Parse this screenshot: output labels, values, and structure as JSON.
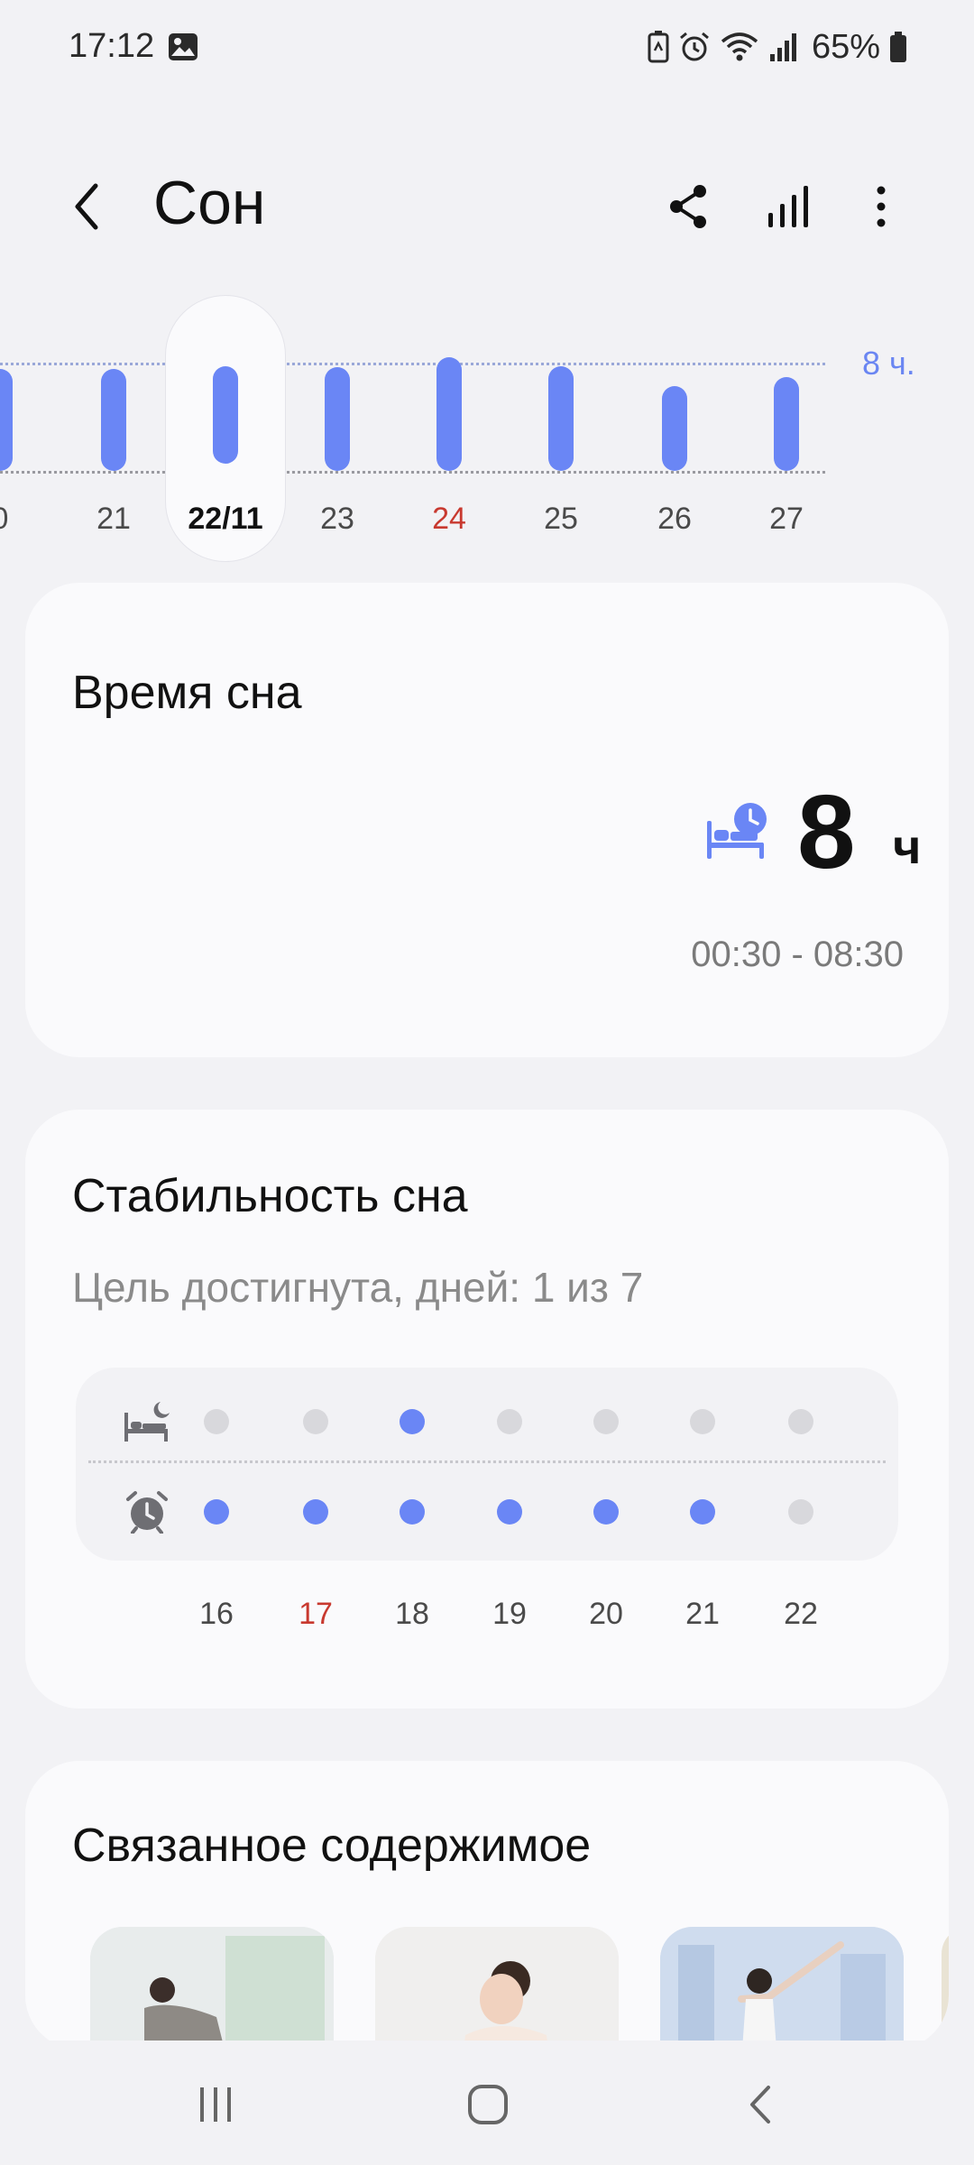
{
  "status_bar": {
    "time": "17:12",
    "battery_text": "65%"
  },
  "header": {
    "title": "Сон"
  },
  "day_strip": {
    "goal_label": "8 ч.",
    "days": [
      {
        "label": "0",
        "hours": 7.8,
        "selected": false,
        "weekend": false
      },
      {
        "label": "21",
        "hours": 7.8,
        "selected": false,
        "weekend": false
      },
      {
        "label": "22/11",
        "hours": 8.0,
        "selected": true,
        "weekend": false
      },
      {
        "label": "23",
        "hours": 7.9,
        "selected": false,
        "weekend": false
      },
      {
        "label": "24",
        "hours": 8.7,
        "selected": false,
        "weekend": true
      },
      {
        "label": "25",
        "hours": 8.0,
        "selected": false,
        "weekend": false
      },
      {
        "label": "26",
        "hours": 6.5,
        "selected": false,
        "weekend": false
      },
      {
        "label": "27",
        "hours": 7.2,
        "selected": false,
        "weekend": false
      }
    ]
  },
  "sleep_time_card": {
    "title": "Время сна",
    "hours_value": "8",
    "hours_unit": "ч",
    "range": "00:30 - 08:30"
  },
  "stability_card": {
    "title": "Стабильность сна",
    "subtitle": "Цель достигнута, дней: 1 из 7",
    "days": [
      {
        "label": "16",
        "bedtime_met": false,
        "wake_met": true,
        "weekend": false
      },
      {
        "label": "17",
        "bedtime_met": false,
        "wake_met": true,
        "weekend": true
      },
      {
        "label": "18",
        "bedtime_met": true,
        "wake_met": true,
        "weekend": false
      },
      {
        "label": "19",
        "bedtime_met": false,
        "wake_met": true,
        "weekend": false
      },
      {
        "label": "20",
        "bedtime_met": false,
        "wake_met": true,
        "weekend": false
      },
      {
        "label": "21",
        "bedtime_met": false,
        "wake_met": true,
        "weekend": false
      },
      {
        "label": "22",
        "bedtime_met": false,
        "wake_met": false,
        "weekend": false
      }
    ]
  },
  "related_card": {
    "title": "Связанное содержимое"
  },
  "colors": {
    "accent": "#6a86f5",
    "weekend": "#c8392f",
    "card_bg": "#fafafc",
    "page_bg": "#f2f2f5"
  },
  "icons": {
    "status": [
      "photo-icon",
      "battery-saver-icon",
      "alarm-icon",
      "wifi-icon",
      "signal-icon",
      "battery-icon"
    ],
    "header": [
      "back-icon",
      "share-icon",
      "stats-icon",
      "more-icon"
    ],
    "nav": [
      "recents-icon",
      "home-icon",
      "nav-back-icon"
    ]
  }
}
